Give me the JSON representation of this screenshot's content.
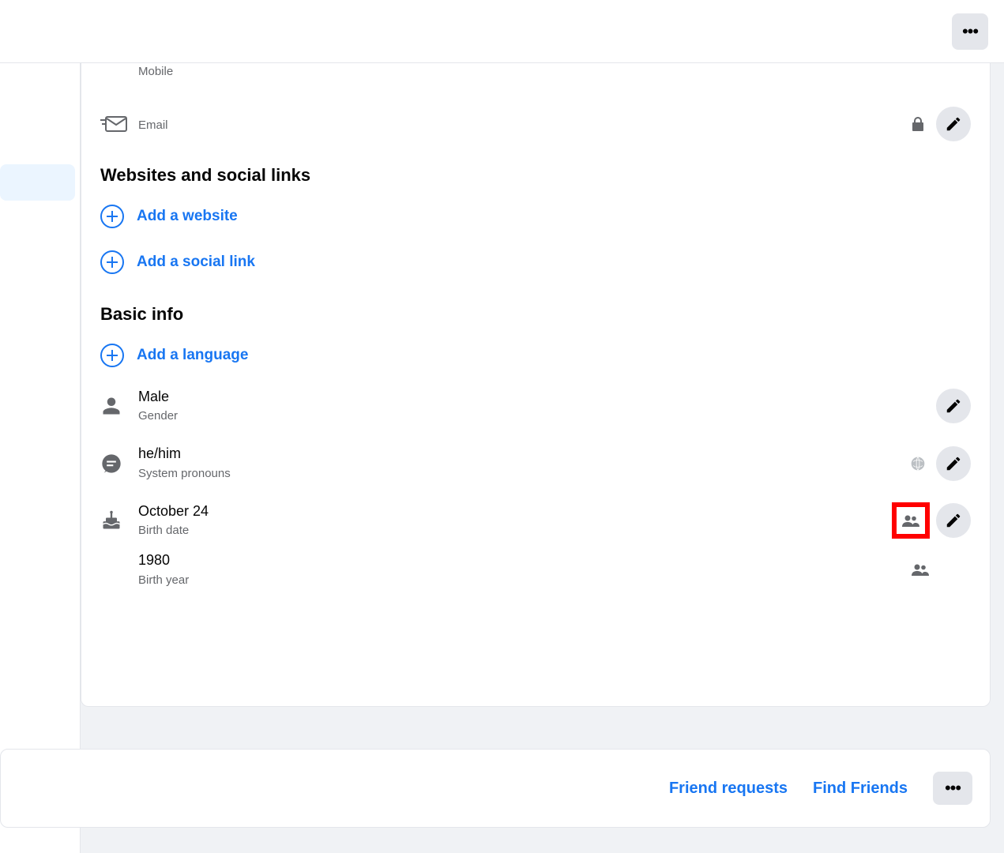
{
  "contact": {
    "mobile_label": "Mobile",
    "email_label": "Email"
  },
  "sections": {
    "websites_heading": "Websites and social links",
    "basic_info_heading": "Basic info"
  },
  "add_links": {
    "website": "Add a website",
    "social": "Add a social link",
    "language": "Add a language"
  },
  "basic": {
    "gender_value": "Male",
    "gender_label": "Gender",
    "pronouns_value": "he/him",
    "pronouns_label": "System pronouns",
    "birth_date_value": "October 24",
    "birth_date_label": "Birth date",
    "birth_year_value": "1980",
    "birth_year_label": "Birth year"
  },
  "friends": {
    "requests": "Friend requests",
    "find": "Find Friends"
  }
}
